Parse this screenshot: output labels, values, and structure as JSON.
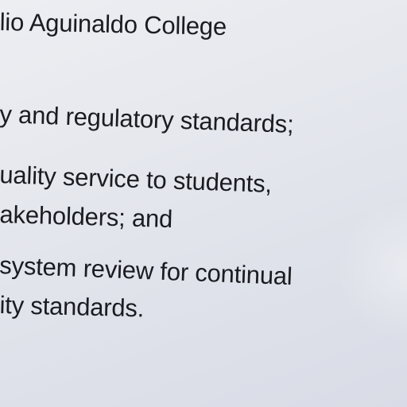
{
  "document": {
    "header": "lio Aguinaldo College",
    "lines": [
      "y and regulatory standards;",
      "uality service to students,",
      "akeholders; and",
      "system review for continual",
      "ity standards."
    ]
  }
}
